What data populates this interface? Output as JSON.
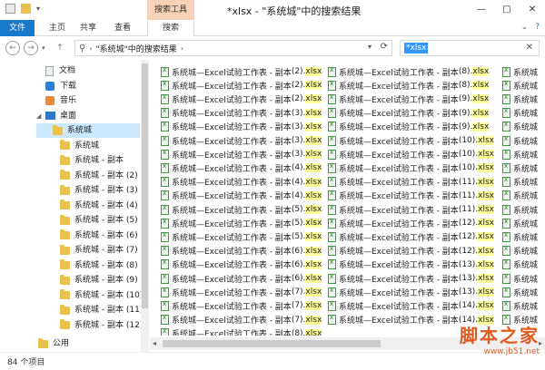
{
  "window": {
    "title": "*xlsx - \"系统城\"中的搜索结果",
    "contextual_group": "搜索工具",
    "buttons": [
      "—",
      "□",
      "✕"
    ]
  },
  "ribbon": {
    "tabs": [
      "文件",
      "主页",
      "共享",
      "查看",
      "搜索"
    ],
    "right_controls": [
      "⌄",
      "?"
    ]
  },
  "address": {
    "path": "\"系统城\"中的搜索结果",
    "search_value": "*xlsx"
  },
  "nav": {
    "items": [
      {
        "label": "文档",
        "icon": "document-icon",
        "level": 1
      },
      {
        "label": "下载",
        "icon": "download-icon",
        "level": 1
      },
      {
        "label": "音乐",
        "icon": "music-icon",
        "level": 1
      },
      {
        "label": "桌面",
        "icon": "desktop-icon",
        "level": 1,
        "expanded": true
      },
      {
        "label": "系统城",
        "icon": "folder-icon",
        "level": 2,
        "selected": true
      },
      {
        "label": "系统城",
        "icon": "folder-icon",
        "level": 3
      },
      {
        "label": "系统城 - 副本",
        "icon": "folder-icon",
        "level": 3
      },
      {
        "label": "系统城 - 副本 (2)",
        "icon": "folder-icon",
        "level": 3
      },
      {
        "label": "系统城 - 副本 (3)",
        "icon": "folder-icon",
        "level": 3
      },
      {
        "label": "系统城 - 副本 (4)",
        "icon": "folder-icon",
        "level": 3
      },
      {
        "label": "系统城 - 副本 (5)",
        "icon": "folder-icon",
        "level": 3
      },
      {
        "label": "系统城 - 副本 (6)",
        "icon": "folder-icon",
        "level": 3
      },
      {
        "label": "系统城 - 副本 (7)",
        "icon": "folder-icon",
        "level": 3
      },
      {
        "label": "系统城 - 副本 (8)",
        "icon": "folder-icon",
        "level": 3
      },
      {
        "label": "系统城 - 副本 (9)",
        "icon": "folder-icon",
        "level": 3
      },
      {
        "label": "系统城 - 副本 (10)",
        "icon": "folder-icon",
        "level": 3
      },
      {
        "label": "系统城 - 副本 (11)",
        "icon": "folder-icon",
        "level": 3
      },
      {
        "label": "系统城 - 副本 (12)",
        "icon": "folder-icon",
        "level": 3
      },
      {
        "label": "公用",
        "icon": "folder-icon",
        "level": 1
      }
    ]
  },
  "files": {
    "prefix": "系统城—Excel试验工作表 - 副本 ",
    "col1": [
      "(2).",
      "(2).",
      "(2).",
      "(3).",
      "(3).",
      "(3).",
      "(3).",
      "(4).",
      "(4).",
      "(4).",
      "(5).",
      "(5).",
      "(5).",
      "(6).",
      "(6).",
      "(6).",
      "(7).",
      "(7).",
      "(7).",
      "(8)."
    ],
    "col2": [
      "(8).",
      "(8).",
      "(9).",
      "(9).",
      "(9).",
      "(10).",
      "(10).",
      "(10).",
      "(11).",
      "(11).",
      "(11).",
      "(12).",
      "(12).",
      "(12).",
      "(13).",
      "(13).",
      "(13).",
      "(14).",
      "(14)."
    ],
    "ext": "xlsx",
    "col3_label": "系统城"
  },
  "status": {
    "count": "84 个项目"
  },
  "watermark": {
    "text": "脚本之家",
    "url": "www.jb51.net"
  }
}
